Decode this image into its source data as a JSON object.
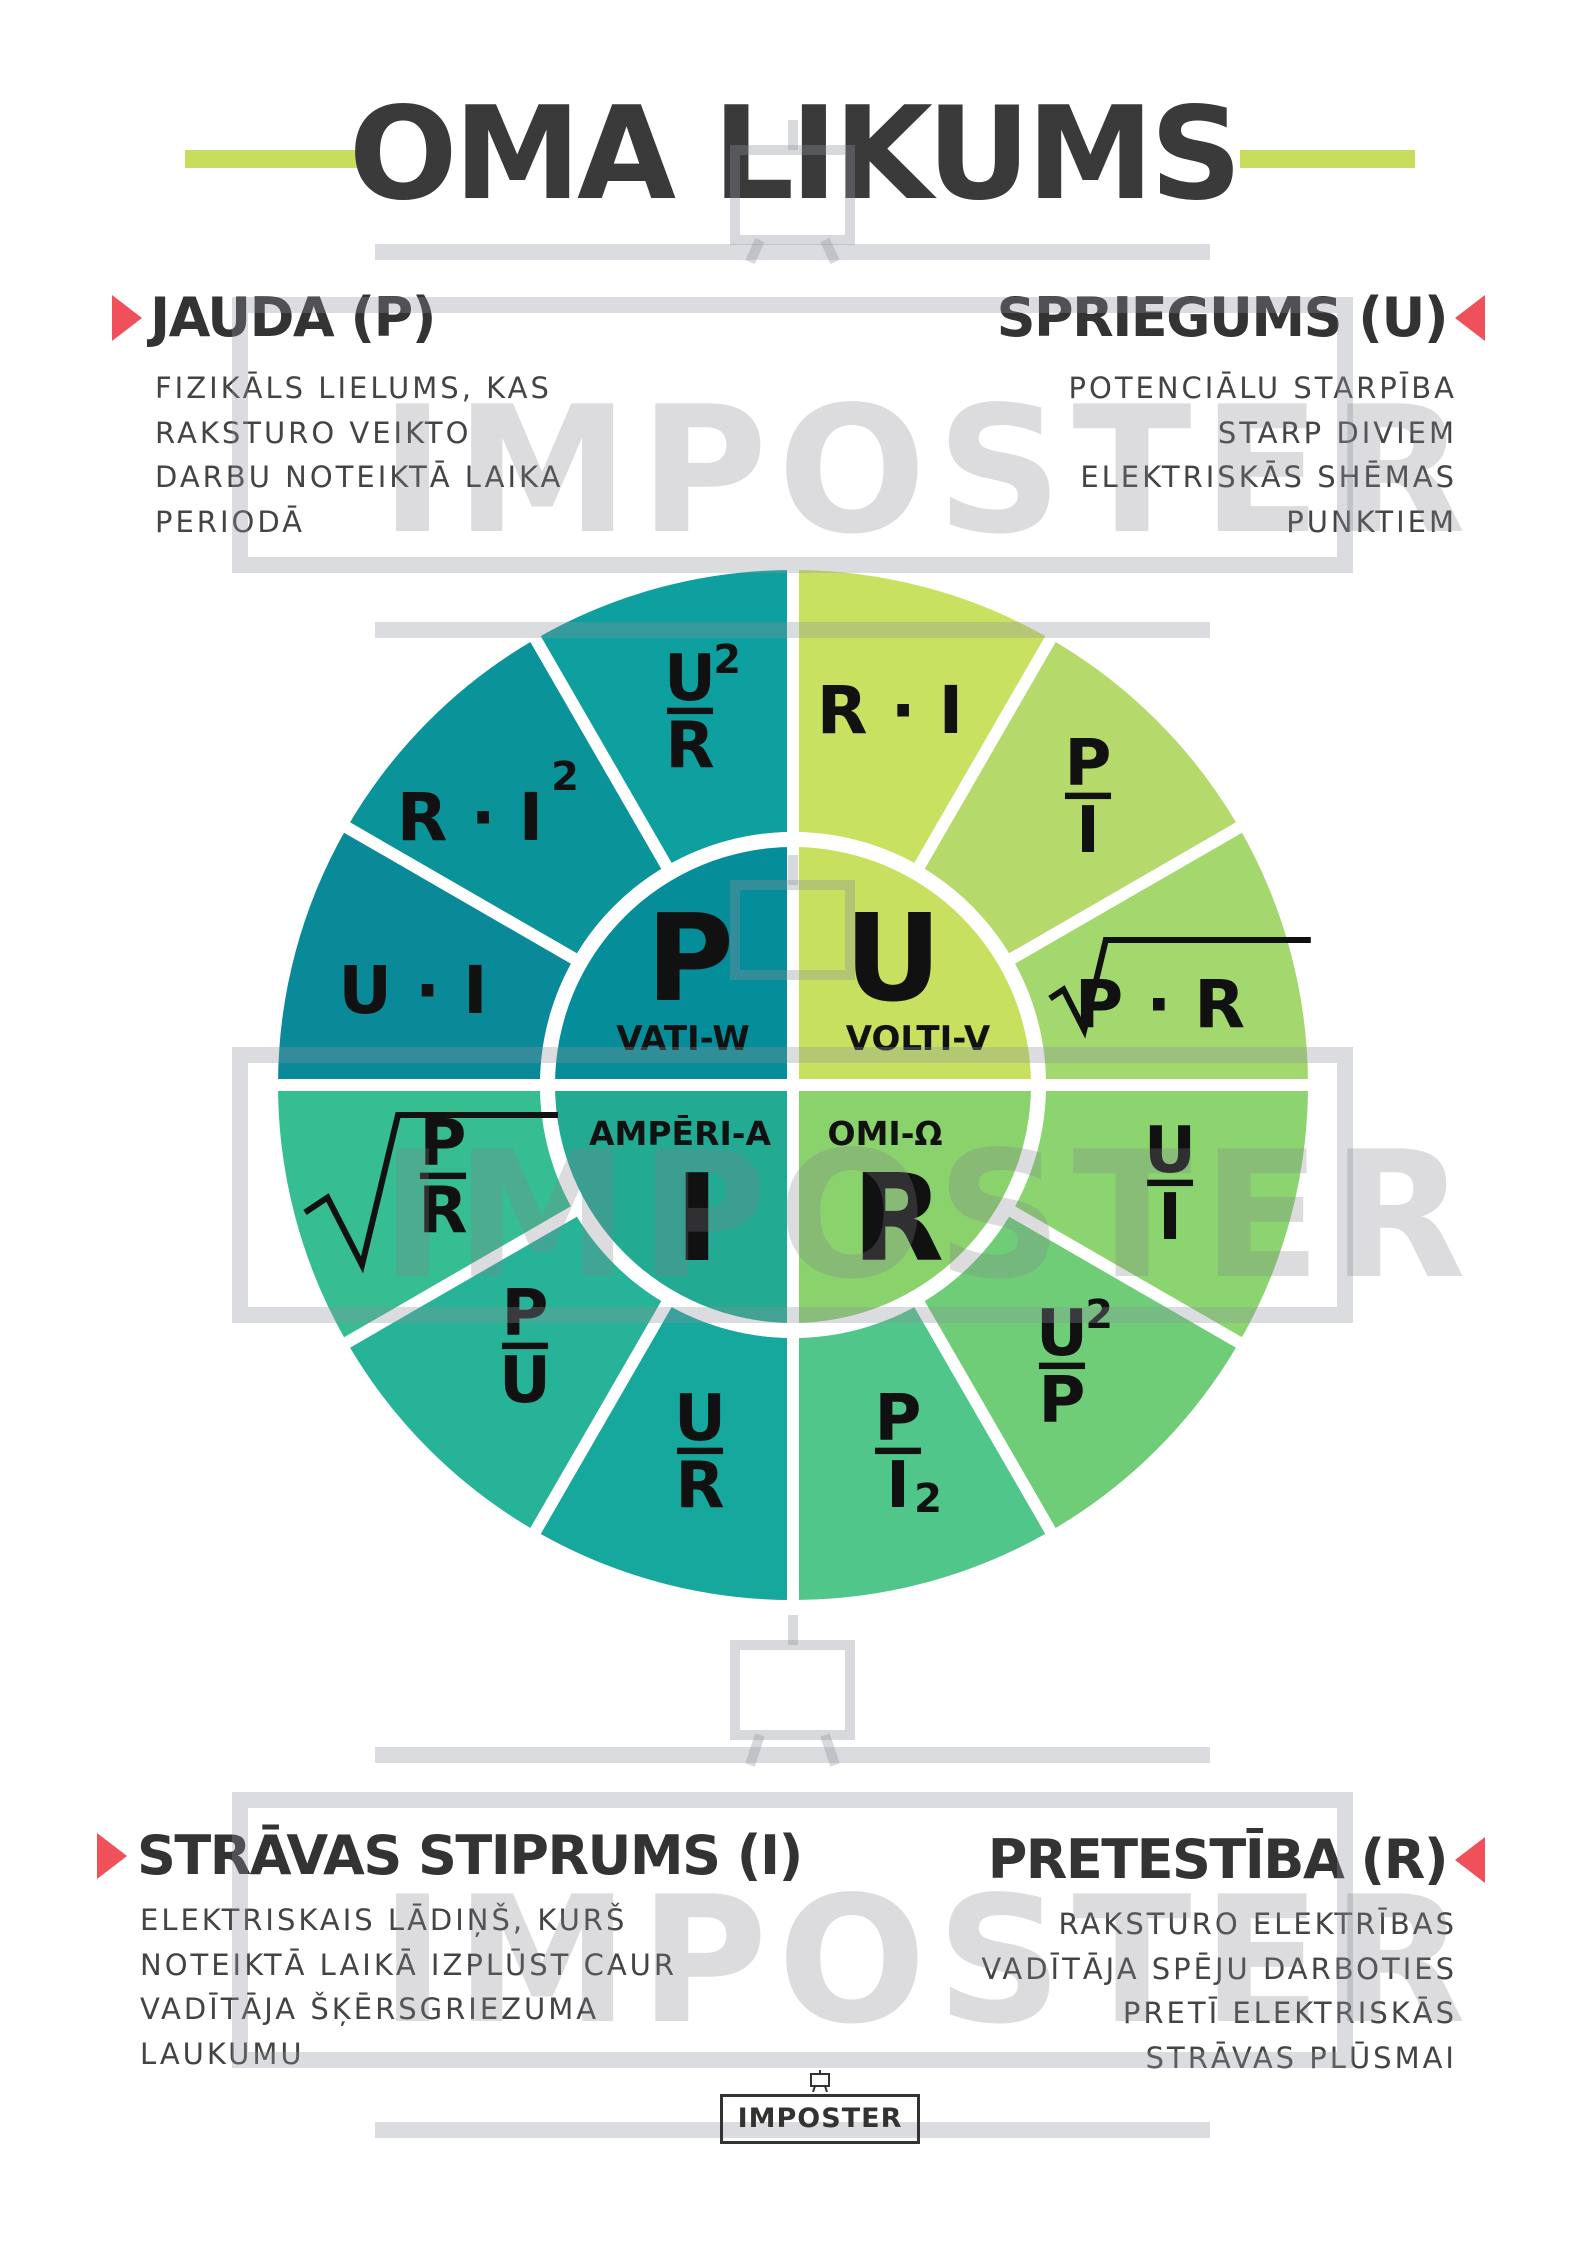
{
  "title": "OMA LIKUMS",
  "sections": {
    "power": {
      "head": "JAUDA (P)",
      "lines": [
        "FIZIKĀLS LIELUMS, KAS",
        "RAKSTURO VEIKTO",
        "DARBU NOTEIKTĀ LAIKA",
        "PERIODĀ"
      ]
    },
    "voltage": {
      "head": "SPRIEGUMS (U)",
      "lines": [
        "POTENCIĀLU STARPĪBA",
        "STARP DIVIEM",
        "ELEKTRISKĀS SHĒMAS",
        "PUNKTIEM"
      ]
    },
    "current": {
      "head": "STRĀVAS STIPRUMS (I)",
      "lines": [
        "ELEKTRISKAIS LĀDIŅŠ, KURŠ",
        "NOTEIKTĀ LAIKĀ IZPLŪST CAUR",
        "VADĪTĀJA ŠĶĒRSGRIEZUMA",
        "LAUKUMU"
      ]
    },
    "resistance": {
      "head": "PRETESTĪBA (R)",
      "lines": [
        "RAKSTURO ELEKTRĪBAS",
        "VADĪTĀJA SPĒJU DARBOTIES",
        "PRETĪ ELEKTRISKĀS",
        "STRĀVAS PLŪSMAI"
      ]
    }
  },
  "wheel": {
    "center": {
      "P": {
        "letter": "P",
        "unit": "VATI-W"
      },
      "U": {
        "letter": "U",
        "unit": "VOLTI-V"
      },
      "I": {
        "letter": "I",
        "unit": "AMPĒRI-A"
      },
      "R": {
        "letter": "R",
        "unit": "OMI-Ω"
      }
    },
    "formulas": {
      "p1": "R · I",
      "p1_exp": "2",
      "p2": "U · I",
      "u1": "R · I",
      "u2": "P · R",
      "i2_exp": "2",
      "r_exp": "2"
    },
    "fraction_letters": {
      "U": "U",
      "R": "R",
      "P": "P",
      "I": "I"
    },
    "colors": {
      "P_inner": "#058d99",
      "U_inner": "#c8e05f",
      "I_inner": "#22aa92",
      "R_inner": "#8ad26c",
      "P_seg": [
        "#0a8a98",
        "#0b939a",
        "#0ea09e"
      ],
      "U_seg": [
        "#c9e160",
        "#b5da6b",
        "#a3d86e"
      ],
      "I_seg": [
        "#17a89d",
        "#27b397",
        "#36bd92"
      ],
      "R_seg": [
        "#8bd46f",
        "#6fcd78",
        "#50c68a"
      ]
    }
  },
  "logo": {
    "label": "IMPOSTER"
  },
  "watermark": {
    "label": "IMPOSTER"
  }
}
